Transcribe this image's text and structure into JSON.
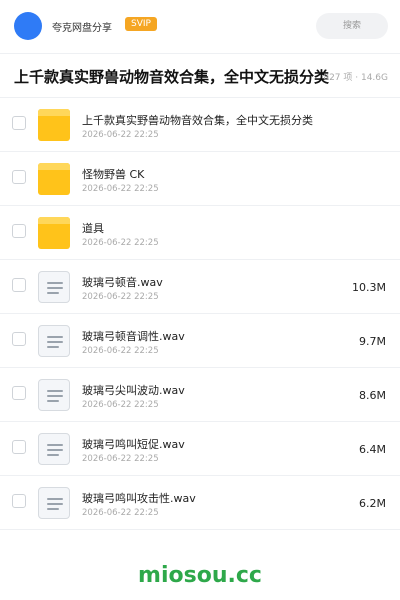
{
  "header": {
    "user_name": "夸克网盘分享",
    "badge": "SVIP",
    "search_placeholder": "搜索"
  },
  "title": "上千款真实野兽动物音效合集，全中文无损分类",
  "meta": "827 项 · 14.6G",
  "files": [
    {
      "name": "上千款真实野兽动物音效合集，全中文无损分类",
      "date": "2026-06-22 22:25",
      "size": "",
      "type": "folder"
    },
    {
      "name": "怪物野兽 CK",
      "date": "2026-06-22 22:25",
      "size": "",
      "type": "folder"
    },
    {
      "name": "道具",
      "date": "2026-06-22 22:25",
      "size": "",
      "type": "folder"
    },
    {
      "name": "玻璃弓顿音.wav",
      "date": "2026-06-22 22:25",
      "size": "10.3M",
      "type": "file"
    },
    {
      "name": "玻璃弓顿音调性.wav",
      "date": "2026-06-22 22:25",
      "size": "9.7M",
      "type": "file"
    },
    {
      "name": "玻璃弓尖叫波动.wav",
      "date": "2026-06-22 22:25",
      "size": "8.6M",
      "type": "file"
    },
    {
      "name": "玻璃弓鸣叫短促.wav",
      "date": "2026-06-22 22:25",
      "size": "6.4M",
      "type": "file"
    },
    {
      "name": "玻璃弓鸣叫攻击性.wav",
      "date": "2026-06-22 22:25",
      "size": "6.2M",
      "type": "file"
    }
  ],
  "watermark": "miosou.cc",
  "colors": {
    "avatar": "#2f7bf6",
    "badge": "#f5a623",
    "folder": "#ffc31a",
    "watermark": "#2ea84a"
  }
}
